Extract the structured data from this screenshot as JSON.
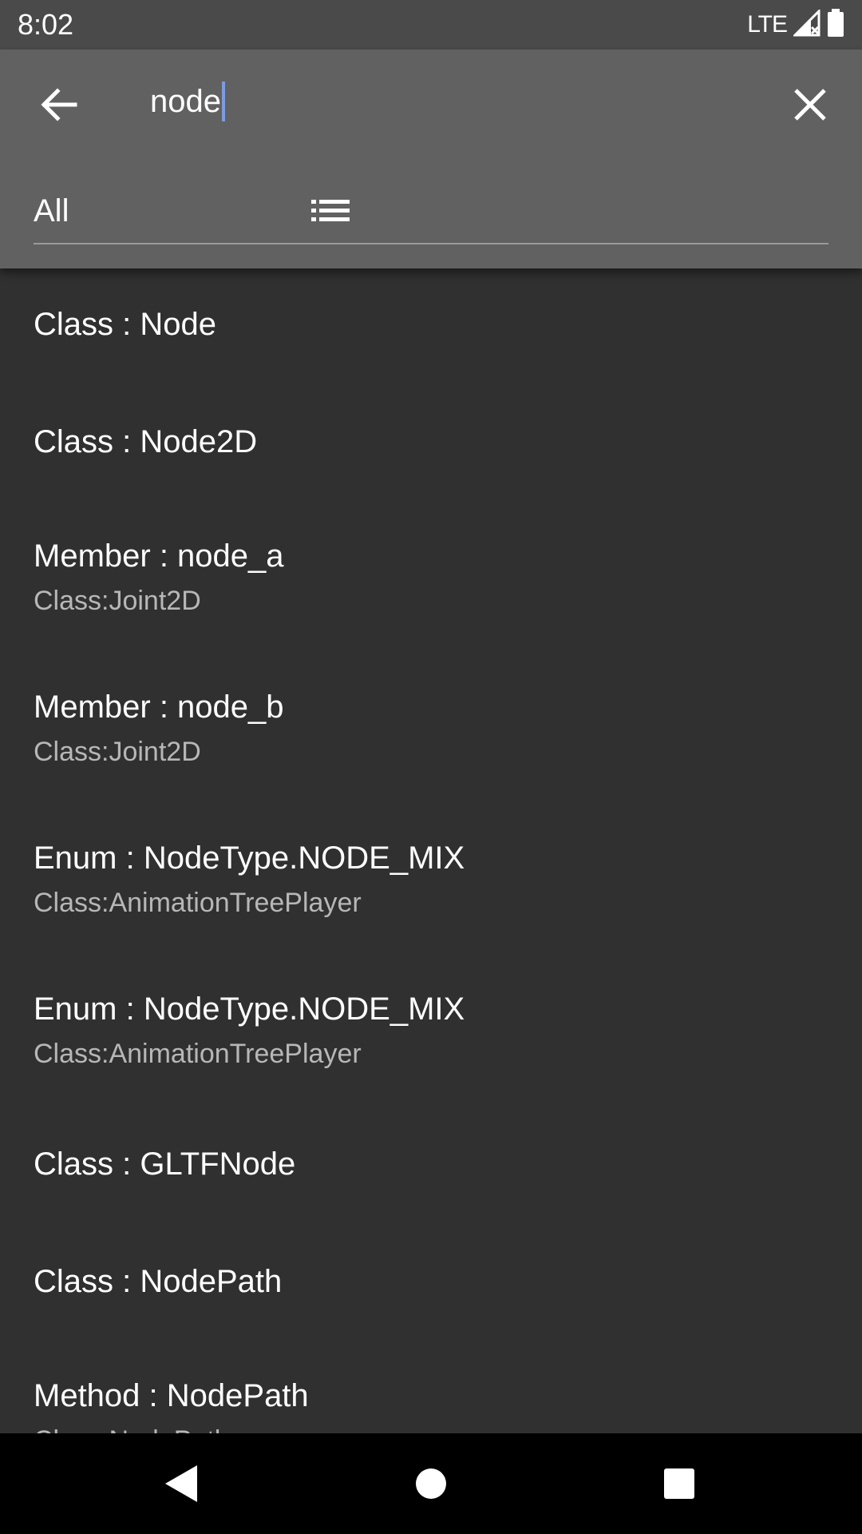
{
  "status_bar": {
    "time": "8:02",
    "network": "LTE",
    "icons": [
      "signal-icon",
      "battery-icon"
    ]
  },
  "search": {
    "value": "node",
    "back_icon": "arrow-back-icon",
    "clear_icon": "close-icon"
  },
  "filter": {
    "selected": "All",
    "icon": "list-icon"
  },
  "results": [
    {
      "title": "Class : Node",
      "subtitle": ""
    },
    {
      "title": "Class : Node2D",
      "subtitle": ""
    },
    {
      "title": "Member : node_a",
      "subtitle": "Class:Joint2D"
    },
    {
      "title": "Member : node_b",
      "subtitle": "Class:Joint2D"
    },
    {
      "title": "Enum : NodeType.NODE_MIX",
      "subtitle": "Class:AnimationTreePlayer"
    },
    {
      "title": "Enum : NodeType.NODE_MIX",
      "subtitle": "Class:AnimationTreePlayer"
    },
    {
      "title": "Class : GLTFNode",
      "subtitle": ""
    },
    {
      "title": "Class : NodePath",
      "subtitle": ""
    },
    {
      "title": "Method : NodePath",
      "subtitle": "Class:NodePath"
    }
  ],
  "nav_bar": {
    "icons": [
      "back-triangle-icon",
      "home-circle-icon",
      "recents-square-icon"
    ]
  },
  "colors": {
    "status_bar": "#4a4a4a",
    "toolbar": "#616161",
    "background": "#303030",
    "caret": "#7d9be0",
    "subtitle": "#b7b7b7"
  }
}
